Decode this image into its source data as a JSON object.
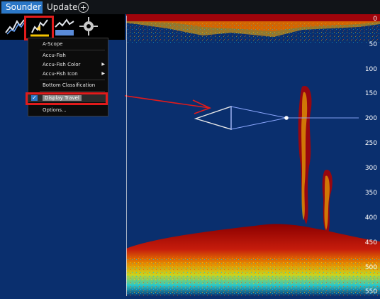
{
  "tabs": [
    {
      "label": "Sounder"
    },
    {
      "label": "Update"
    }
  ],
  "menu": {
    "items": [
      {
        "label": "A-Scope"
      },
      {
        "label": "Accu-Fish"
      },
      {
        "label": "Accu-Fish Color"
      },
      {
        "label": "Accu-Fish Icon"
      },
      {
        "label": "Bottom Classification"
      },
      {
        "label": "Display Travel"
      },
      {
        "label": "Options..."
      }
    ]
  },
  "depth_scale": [
    "0",
    "50",
    "100",
    "150",
    "200",
    "250",
    "300",
    "350",
    "400",
    "450",
    "500",
    "550"
  ],
  "colors": {
    "background": "#0a2f6e",
    "accent": "#2b77c7",
    "highlight": "#e11b1b"
  }
}
